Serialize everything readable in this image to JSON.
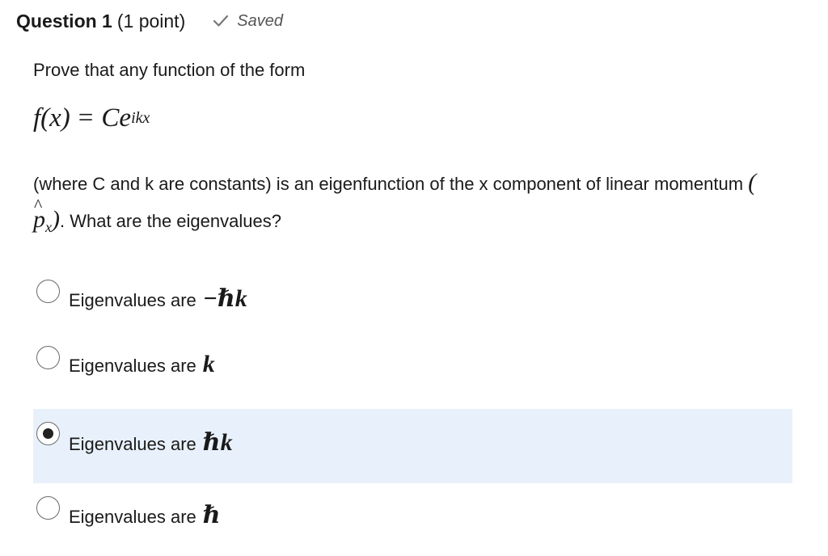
{
  "header": {
    "title": "Question 1",
    "points": "(1 point)",
    "status_icon": "check-icon",
    "status": "Saved"
  },
  "question": {
    "intro": "Prove that any function of the form",
    "formula_lhs": "f(x)",
    "formula_rel": "=",
    "formula_rhs_base": "Ce",
    "formula_rhs_exp": "ikx",
    "text_part1": "(where C and k are constants) is an eigenfunction of the x component of linear momentum",
    "operator_p": "p",
    "operator_sub": "x",
    "text_part2": ". What are the eigenvalues?"
  },
  "options": [
    {
      "prefix": "Eigenvalues are",
      "math": "−ℏk",
      "selected": false
    },
    {
      "prefix": "Eigenvalues are",
      "math": "k",
      "selected": false
    },
    {
      "prefix": "Eigenvalues are",
      "math": "ℏk",
      "selected": true
    },
    {
      "prefix": "Eigenvalues are",
      "math": "ℏ",
      "selected": false
    }
  ],
  "colors": {
    "selected_bg": "#e8f1fb",
    "text": "#1a1a1a",
    "saved_text": "#555555"
  }
}
